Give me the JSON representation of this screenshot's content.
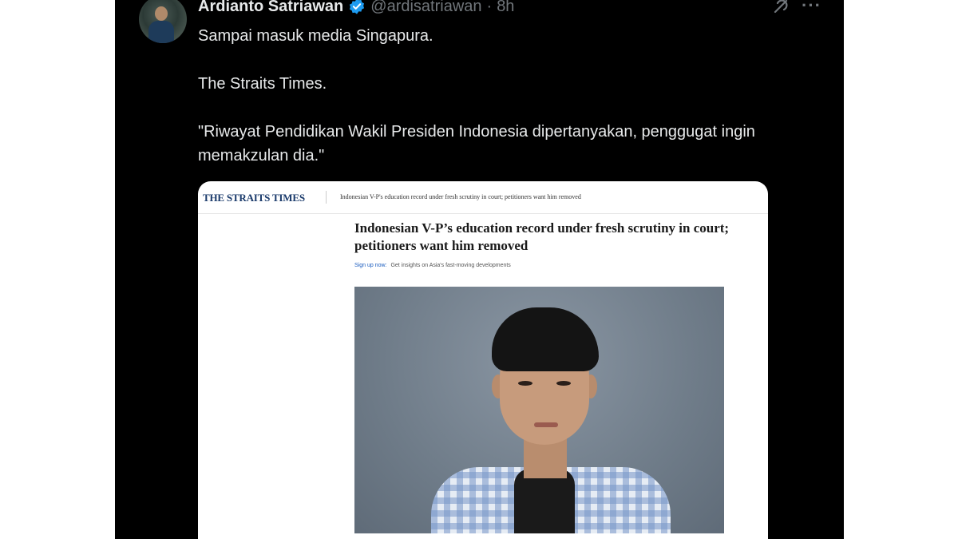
{
  "tweet": {
    "display_name": "Ardianto Satriawan",
    "handle": "@ardisatriawan",
    "separator": "·",
    "time": "8h",
    "more_label": "···",
    "paragraphs": [
      "Sampai masuk media Singapura.",
      "The Straits Times.",
      "\"Riwayat Pendidikan Wakil Presiden Indonesia dipertanyakan, penggugat ingin memakzulan dia.\""
    ],
    "icons": {
      "verified": "verified-badge-icon",
      "grok": "grok-icon",
      "more": "more-options-icon"
    },
    "colors": {
      "background": "#000000",
      "text": "#e7e9ea",
      "muted": "#71767b",
      "verified": "#1d9bf0"
    }
  },
  "article_card": {
    "publication_logo": "THE STRAITS TIMES",
    "nav_headline": "Indonesian V-P's education record under fresh scrutiny in court; petitioners want him removed",
    "title": "Indonesian V-P’s education record under fresh scrutiny in court; petitioners want him removed",
    "signup_link": "Sign up now:",
    "signup_text": "Get insights on Asia's fast-moving developments",
    "colors": {
      "logo": "#1a3a6b",
      "link": "#1a5cbf"
    }
  }
}
